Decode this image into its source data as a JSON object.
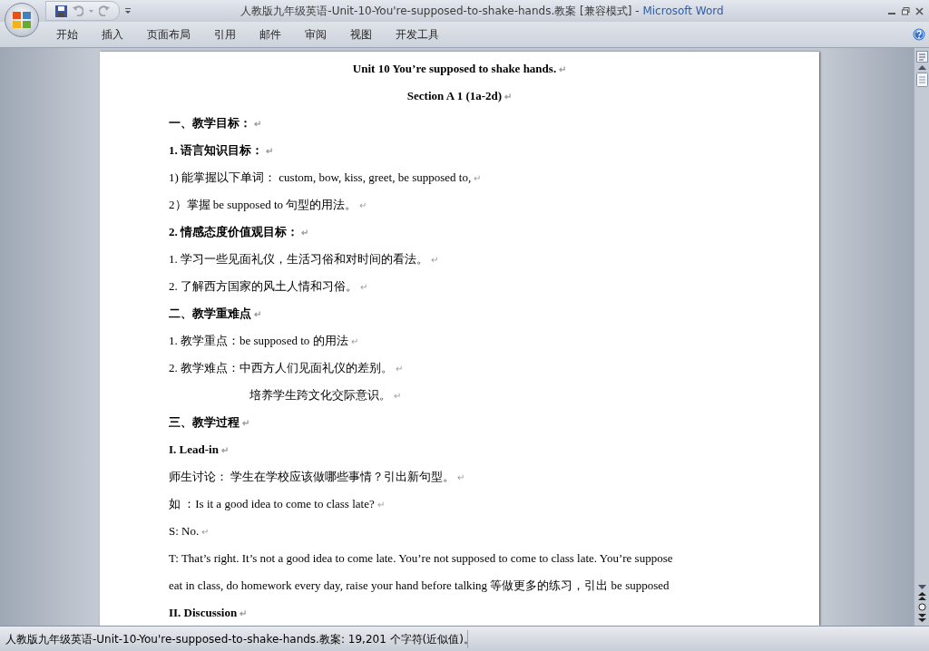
{
  "window": {
    "title": "人教版九年级英语-Unit-10-You're-supposed-to-shake-hands.教案 [兼容模式]",
    "separator": "-",
    "app_name": "Microsoft Word"
  },
  "ribbon": {
    "tabs": [
      {
        "label": "开始",
        "selected": false
      },
      {
        "label": "插入",
        "selected": false
      },
      {
        "label": "页面布局",
        "selected": false
      },
      {
        "label": "引用",
        "selected": false
      },
      {
        "label": "邮件",
        "selected": false
      },
      {
        "label": "审阅",
        "selected": false
      },
      {
        "label": "视图",
        "selected": false
      },
      {
        "label": "开发工具",
        "selected": false
      }
    ]
  },
  "document": {
    "paragraphs": [
      {
        "kind": "title",
        "text": "Unit 10 You’re supposed to shake hands.",
        "mark": "↵"
      },
      {
        "kind": "title",
        "text": "Section A 1 (1a-2d)",
        "mark": "↵"
      },
      {
        "kind": "heading",
        "text": "一、教学目标：",
        "mark": "↵"
      },
      {
        "kind": "heading",
        "text": "1. 语言知识目标：",
        "mark": "↵"
      },
      {
        "kind": "body",
        "text": "1) 能掌握以下单词：  custom, bow, kiss, greet, be supposed to,",
        "mark": "↵"
      },
      {
        "kind": "body",
        "text": "2）掌握 be supposed to 句型的用法。",
        "mark": "↵"
      },
      {
        "kind": "heading",
        "text": "2. 情感态度价值观目标：",
        "mark": "↵"
      },
      {
        "kind": "body",
        "text": "1. 学习一些见面礼仪，生活习俗和对时间的看法。",
        "mark": "↵"
      },
      {
        "kind": "body",
        "text": "2. 了解西方国家的风土人情和习俗。",
        "mark": "↵"
      },
      {
        "kind": "heading",
        "text": "二、教学重难点",
        "mark": "↵"
      },
      {
        "kind": "body",
        "text": "1. 教学重点：be supposed to 的用法",
        "mark": "↵"
      },
      {
        "kind": "body",
        "text": "2. 教学难点：中西方人们见面礼仪的差别。",
        "mark": "↵"
      },
      {
        "kind": "indented",
        "text": "培养学生跨文化交际意识。",
        "mark": "↵"
      },
      {
        "kind": "heading",
        "text": "三、教学过程",
        "mark": "↵"
      },
      {
        "kind": "heading",
        "text": "I. Lead-in",
        "mark": "↵"
      },
      {
        "kind": "body",
        "text": "师生讨论： 学生在学校应该做哪些事情？引出新句型。",
        "mark": "↵"
      },
      {
        "kind": "body",
        "text": "如 ：Is it a good idea to come to class late?",
        "mark": "↵"
      },
      {
        "kind": "body",
        "text": "S: No.",
        "mark": "↵"
      },
      {
        "kind": "body",
        "text": "T: That’s right. It’s not a good idea to come late. You’re not supposed to come to class late. You’re suppose"
      },
      {
        "kind": "body",
        "text": "eat in class, do homework every day, raise your hand before talking 等做更多的练习，引出 be supposed"
      },
      {
        "kind": "heading",
        "text": "II. Discussion",
        "mark": "↵"
      }
    ]
  },
  "status_bar": {
    "text": "人教版九年级英语-Unit-10-You're-supposed-to-shake-hands.教案: 19,201 个字符(近似值)。"
  }
}
